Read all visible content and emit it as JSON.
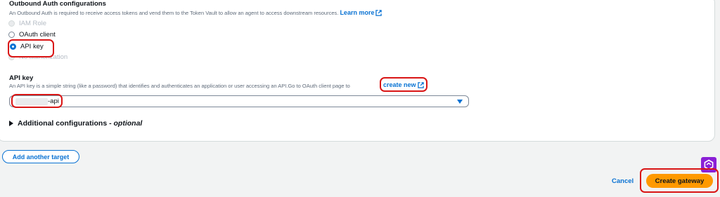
{
  "outbound": {
    "title": "Outbound Auth configurations",
    "description": "An Outbound Auth is required to receive access tokens and vend them to the Token Vault to allow an agent to access downstream resources.",
    "learn_more": "Learn more",
    "options": [
      {
        "label": "IAM Role",
        "state": "disabled"
      },
      {
        "label": "OAuth client",
        "state": "unselected"
      },
      {
        "label": "API key",
        "state": "selected"
      },
      {
        "label": "No authorization",
        "state": "disabled"
      }
    ]
  },
  "api_key": {
    "title": "API key",
    "description": "An API key is a simple string (like a password) that identifies and authenticates an application or user accessing an API.Go to OAuth client page to",
    "create_new": "create new",
    "selected_value": "-api"
  },
  "additional": {
    "label": "Additional configurations -",
    "optional": "optional"
  },
  "actions": {
    "add_target": "Add another target",
    "cancel": "Cancel",
    "create": "Create gateway"
  },
  "colors": {
    "accent": "#0972d3",
    "primary_button": "#ff9900",
    "highlight": "#d91515",
    "extension": "#8a1fd6"
  }
}
